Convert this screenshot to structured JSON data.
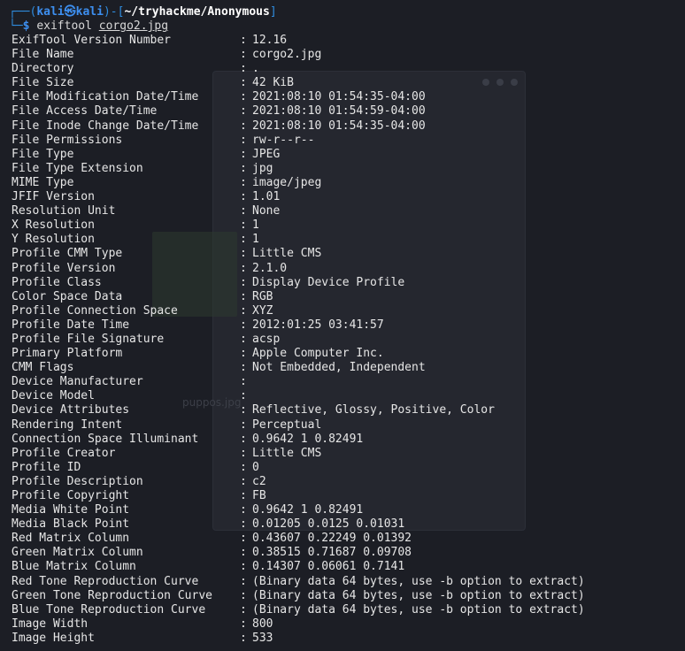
{
  "prompt": {
    "user": "kali",
    "host": "kali",
    "path": "~/tryhackme/Anonymous",
    "command": "exiftool",
    "argument": "corgo2.jpg"
  },
  "background_window": {
    "caption": "puppos.jpg"
  },
  "separator": ":",
  "rows": [
    {
      "key": "ExifTool Version Number",
      "value": "12.16"
    },
    {
      "key": "File Name",
      "value": "corgo2.jpg"
    },
    {
      "key": "Directory",
      "value": "."
    },
    {
      "key": "File Size",
      "value": "42 KiB"
    },
    {
      "key": "File Modification Date/Time",
      "value": "2021:08:10 01:54:35-04:00"
    },
    {
      "key": "File Access Date/Time",
      "value": "2021:08:10 01:54:59-04:00"
    },
    {
      "key": "File Inode Change Date/Time",
      "value": "2021:08:10 01:54:35-04:00"
    },
    {
      "key": "File Permissions",
      "value": "rw-r--r--"
    },
    {
      "key": "File Type",
      "value": "JPEG"
    },
    {
      "key": "File Type Extension",
      "value": "jpg"
    },
    {
      "key": "MIME Type",
      "value": "image/jpeg"
    },
    {
      "key": "JFIF Version",
      "value": "1.01"
    },
    {
      "key": "Resolution Unit",
      "value": "None"
    },
    {
      "key": "X Resolution",
      "value": "1"
    },
    {
      "key": "Y Resolution",
      "value": "1"
    },
    {
      "key": "Profile CMM Type",
      "value": "Little CMS"
    },
    {
      "key": "Profile Version",
      "value": "2.1.0"
    },
    {
      "key": "Profile Class",
      "value": "Display Device Profile"
    },
    {
      "key": "Color Space Data",
      "value": "RGB"
    },
    {
      "key": "Profile Connection Space",
      "value": "XYZ"
    },
    {
      "key": "Profile Date Time",
      "value": "2012:01:25 03:41:57"
    },
    {
      "key": "Profile File Signature",
      "value": "acsp"
    },
    {
      "key": "Primary Platform",
      "value": "Apple Computer Inc."
    },
    {
      "key": "CMM Flags",
      "value": "Not Embedded, Independent"
    },
    {
      "key": "Device Manufacturer",
      "value": ""
    },
    {
      "key": "Device Model",
      "value": ""
    },
    {
      "key": "Device Attributes",
      "value": "Reflective, Glossy, Positive, Color"
    },
    {
      "key": "Rendering Intent",
      "value": "Perceptual"
    },
    {
      "key": "Connection Space Illuminant",
      "value": "0.9642 1 0.82491"
    },
    {
      "key": "Profile Creator",
      "value": "Little CMS"
    },
    {
      "key": "Profile ID",
      "value": "0"
    },
    {
      "key": "Profile Description",
      "value": "c2"
    },
    {
      "key": "Profile Copyright",
      "value": "FB"
    },
    {
      "key": "Media White Point",
      "value": "0.9642 1 0.82491"
    },
    {
      "key": "Media Black Point",
      "value": "0.01205 0.0125 0.01031"
    },
    {
      "key": "Red Matrix Column",
      "value": "0.43607 0.22249 0.01392"
    },
    {
      "key": "Green Matrix Column",
      "value": "0.38515 0.71687 0.09708"
    },
    {
      "key": "Blue Matrix Column",
      "value": "0.14307 0.06061 0.7141"
    },
    {
      "key": "Red Tone Reproduction Curve",
      "value": "(Binary data 64 bytes, use -b option to extract)"
    },
    {
      "key": "Green Tone Reproduction Curve",
      "value": "(Binary data 64 bytes, use -b option to extract)"
    },
    {
      "key": "Blue Tone Reproduction Curve",
      "value": "(Binary data 64 bytes, use -b option to extract)"
    },
    {
      "key": "Image Width",
      "value": "800"
    },
    {
      "key": "Image Height",
      "value": "533"
    }
  ]
}
